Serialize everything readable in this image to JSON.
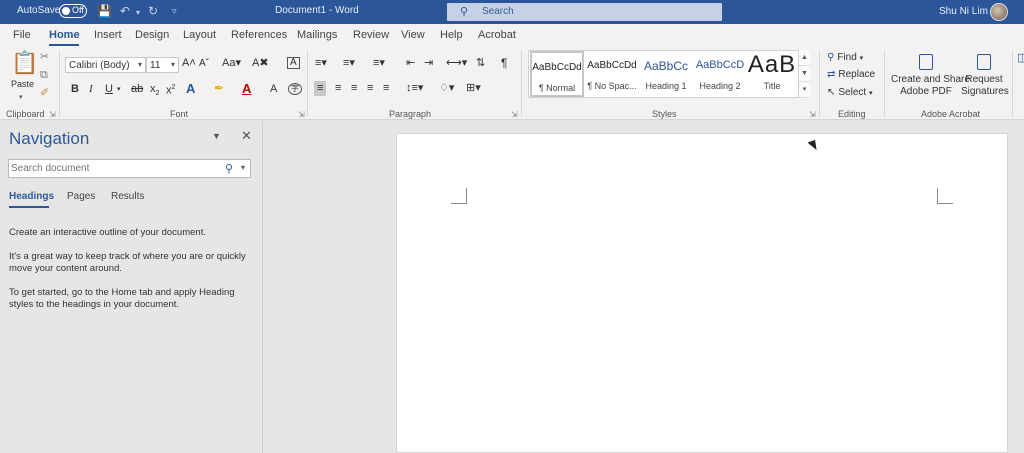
{
  "titlebar": {
    "autosave_label": "AutoSave",
    "autosave_state": "Off",
    "document_title": "Document1  -  Word",
    "search_placeholder": "Search",
    "user_name": "Shu Ni Lim",
    "icons": [
      "save-icon",
      "undo-icon",
      "redo-icon",
      "customize-qat-icon",
      "search-icon",
      "avatar"
    ]
  },
  "menu": {
    "tabs": [
      "File",
      "Home",
      "Insert",
      "Design",
      "Layout",
      "References",
      "Mailings",
      "Review",
      "View",
      "Help",
      "Acrobat"
    ],
    "active": "Home"
  },
  "ribbon": {
    "clipboard": {
      "label": "Clipboard",
      "paste_label": "Paste"
    },
    "font": {
      "label": "Font",
      "font_name": "Calibri (Body)",
      "font_size": "11"
    },
    "paragraph": {
      "label": "Paragraph"
    },
    "styles": {
      "label": "Styles",
      "items": [
        {
          "preview": "AaBbCcDd",
          "name": "¶ Normal"
        },
        {
          "preview": "AaBbCcDd",
          "name": "¶ No Spac..."
        },
        {
          "preview": "AaBbCc",
          "name": "Heading 1"
        },
        {
          "preview": "AaBbCcD",
          "name": "Heading 2"
        },
        {
          "preview": "AaB",
          "name": "Title"
        }
      ]
    },
    "editing": {
      "label": "Editing",
      "find": "Find",
      "replace": "Replace",
      "select": "Select"
    },
    "acrobat": {
      "label": "Adobe Acrobat",
      "create_share": "Create and Share\nAdobe PDF",
      "request_signatures": "Request\nSignatures"
    }
  },
  "navigation": {
    "title": "Navigation",
    "search_placeholder": "Search document",
    "tabs": [
      "Headings",
      "Pages",
      "Results"
    ],
    "active_tab": "Headings",
    "messages": [
      "Create an interactive outline of your document.",
      "It's a great way to keep track of where you are or quickly move your content around.",
      "To get started, go to the Home tab and apply Heading styles to the headings in your document."
    ]
  },
  "colors": {
    "accent": "#2b579a",
    "title_bar": "#2b579a",
    "ribbon_bg": "#f3f2f1",
    "pane_bg": "#e6e6e6"
  }
}
